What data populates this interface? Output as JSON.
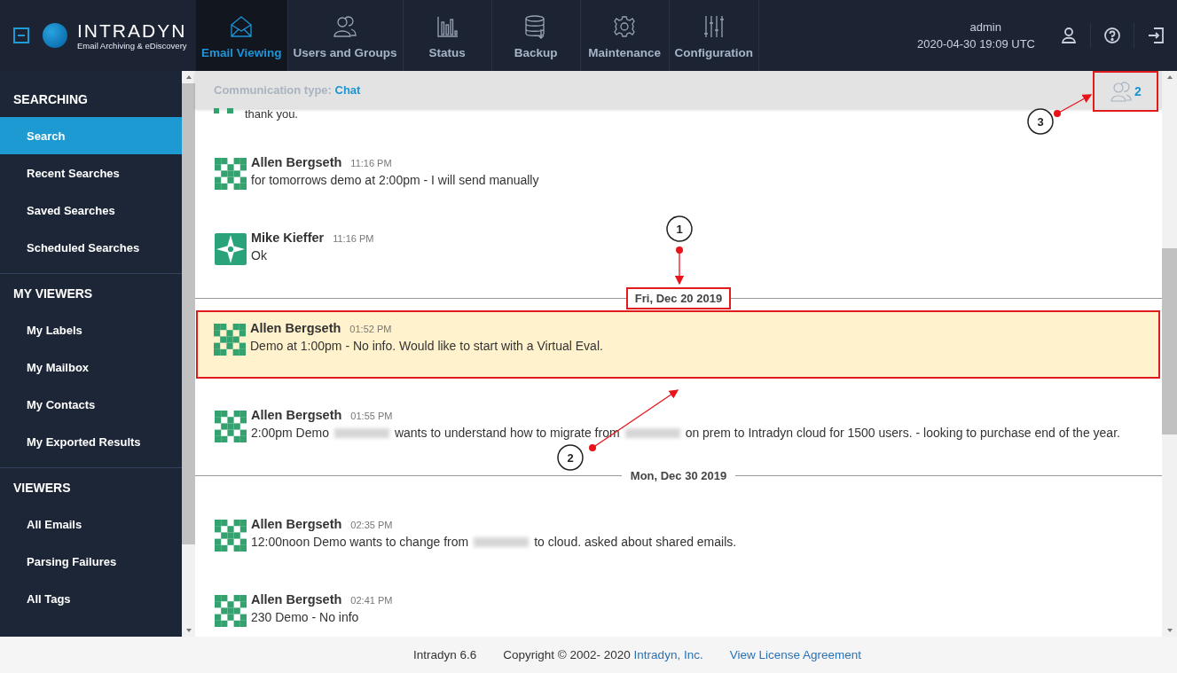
{
  "header": {
    "logo": {
      "name": "INTRADYN",
      "tagline": "Email Archiving & eDiscovery"
    },
    "tabs": [
      {
        "label": "Email Viewing",
        "selected": true
      },
      {
        "label": "Users and Groups",
        "selected": false
      },
      {
        "label": "Status",
        "selected": false
      },
      {
        "label": "Backup",
        "selected": false
      },
      {
        "label": "Maintenance",
        "selected": false
      },
      {
        "label": "Configuration",
        "selected": false
      }
    ],
    "user": "admin",
    "datetime": "2020-04-30 19:09 UTC"
  },
  "sidebar": {
    "sections": [
      {
        "heading": "SEARCHING",
        "items": [
          {
            "label": "Search",
            "selected": true
          },
          {
            "label": "Recent Searches",
            "selected": false
          },
          {
            "label": "Saved Searches",
            "selected": false
          },
          {
            "label": "Scheduled Searches",
            "selected": false
          }
        ]
      },
      {
        "heading": "MY VIEWERS",
        "items": [
          {
            "label": "My Labels",
            "selected": false
          },
          {
            "label": "My Mailbox",
            "selected": false
          },
          {
            "label": "My Contacts",
            "selected": false
          },
          {
            "label": "My Exported Results",
            "selected": false
          }
        ]
      },
      {
        "heading": "VIEWERS",
        "items": [
          {
            "label": "All Emails",
            "selected": false
          },
          {
            "label": "Parsing Failures",
            "selected": false
          },
          {
            "label": "All Tags",
            "selected": false
          }
        ]
      }
    ]
  },
  "conversation": {
    "type_label": "Communication type:",
    "type": "Chat",
    "participants_count": "2",
    "participants_highlighted": true,
    "entries": [
      {
        "kind": "partial",
        "text": "thank you."
      },
      {
        "kind": "message",
        "sender": "Allen Bergseth",
        "time": "11:16 PM",
        "highlighted": false,
        "parts": [
          {
            "kind": "text",
            "text": "for tomorrows demo at 2:00pm  - I will send manually"
          }
        ]
      },
      {
        "kind": "message",
        "sender": "Mike Kieffer",
        "time": "11:16 PM",
        "highlighted": false,
        "parts": [
          {
            "kind": "text",
            "text": "Ok"
          }
        ]
      },
      {
        "kind": "date",
        "label": "Fri, Dec 20 2019",
        "highlighted": true
      },
      {
        "kind": "message",
        "sender": "Allen Bergseth",
        "time": "01:52 PM",
        "highlighted": true,
        "parts": [
          {
            "kind": "text",
            "text": "Demo at 1:00pm - No info.  Would like to start with a Virtual Eval."
          }
        ]
      },
      {
        "kind": "message",
        "sender": "Allen Bergseth",
        "time": "01:55 PM",
        "highlighted": false,
        "parts": [
          {
            "kind": "text",
            "text": "2:00pm Demo"
          },
          {
            "kind": "redacted"
          },
          {
            "kind": "text",
            "text": "wants to understand how to migrate from"
          },
          {
            "kind": "redacted"
          },
          {
            "kind": "text",
            "text": "on prem to Intradyn cloud for 1500 users.   - looking to purchase end of the year."
          }
        ]
      },
      {
        "kind": "date",
        "label": "Mon, Dec 30 2019",
        "highlighted": false
      },
      {
        "kind": "message",
        "sender": "Allen Bergseth",
        "time": "02:35 PM",
        "highlighted": false,
        "parts": [
          {
            "kind": "text",
            "text": "12:00noon Demo wants to change from"
          },
          {
            "kind": "redacted"
          },
          {
            "kind": "text",
            "text": "to cloud.  asked about shared emails."
          }
        ]
      },
      {
        "kind": "message",
        "sender": "Allen Bergseth",
        "time": "02:41 PM",
        "highlighted": false,
        "parts": [
          {
            "kind": "text",
            "text": "230 Demo - No info"
          }
        ]
      }
    ]
  },
  "annotations": [
    {
      "label": "1"
    },
    {
      "label": "2"
    },
    {
      "label": "3"
    }
  ],
  "footer": {
    "version": "Intradyn 6.6",
    "copyright": "Copyright © 2002- 2020",
    "company_link": "Intradyn, Inc.",
    "license_link": "View License Agreement"
  }
}
